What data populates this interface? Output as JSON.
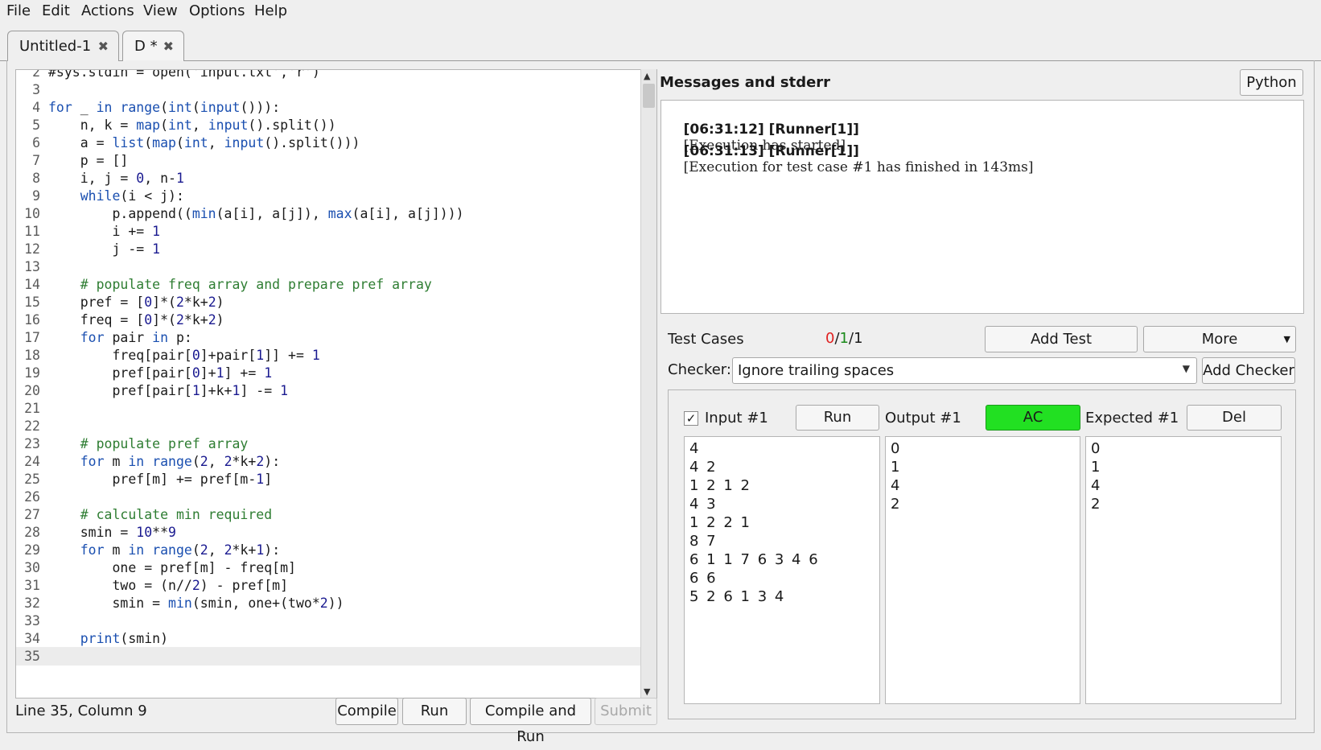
{
  "menu": [
    "File",
    "Edit",
    "Actions",
    "View",
    "Options",
    "Help"
  ],
  "tabs": [
    {
      "label": "Untitled-1"
    },
    {
      "label": "D *"
    }
  ],
  "editor": {
    "lines": [
      {
        "n": "2",
        "html": "#sys.stdin = open('input.txt','r')"
      },
      {
        "n": "3",
        "html": ""
      },
      {
        "n": "4",
        "html": "<span class=\"kw\">for</span> _ <span class=\"kw\">in</span> <span class=\"bi\">range</span>(<span class=\"bi\">int</span>(<span class=\"bi\">input</span>())):"
      },
      {
        "n": "5",
        "html": "    n, k = <span class=\"bi\">map</span>(<span class=\"bi\">int</span>, <span class=\"bi\">input</span>().split())"
      },
      {
        "n": "6",
        "html": "    a = <span class=\"bi\">list</span>(<span class=\"bi\">map</span>(<span class=\"bi\">int</span>, <span class=\"bi\">input</span>().split()))"
      },
      {
        "n": "7",
        "html": "    p = []"
      },
      {
        "n": "8",
        "html": "    i, j = <span class=\"num\">0</span>, n-<span class=\"num\">1</span>"
      },
      {
        "n": "9",
        "html": "    <span class=\"kw\">while</span>(i &lt; j):"
      },
      {
        "n": "10",
        "html": "        p.append((<span class=\"bi\">min</span>(a[i], a[j]), <span class=\"bi\">max</span>(a[i], a[j])))"
      },
      {
        "n": "11",
        "html": "        i += <span class=\"num\">1</span>"
      },
      {
        "n": "12",
        "html": "        j -= <span class=\"num\">1</span>"
      },
      {
        "n": "13",
        "html": ""
      },
      {
        "n": "14",
        "html": "    <span class=\"cmt\"># populate freq array and prepare pref array</span>"
      },
      {
        "n": "15",
        "html": "    pref = [<span class=\"num\">0</span>]*(<span class=\"num\">2</span>*k+<span class=\"num\">2</span>)"
      },
      {
        "n": "16",
        "html": "    freq = [<span class=\"num\">0</span>]*(<span class=\"num\">2</span>*k+<span class=\"num\">2</span>)"
      },
      {
        "n": "17",
        "html": "    <span class=\"kw\">for</span> pair <span class=\"kw\">in</span> p:"
      },
      {
        "n": "18",
        "html": "        freq[pair[<span class=\"num\">0</span>]+pair[<span class=\"num\">1</span>]] += <span class=\"num\">1</span>"
      },
      {
        "n": "19",
        "html": "        pref[pair[<span class=\"num\">0</span>]+<span class=\"num\">1</span>] += <span class=\"num\">1</span>"
      },
      {
        "n": "20",
        "html": "        pref[pair[<span class=\"num\">1</span>]+k+<span class=\"num\">1</span>] -= <span class=\"num\">1</span>"
      },
      {
        "n": "21",
        "html": ""
      },
      {
        "n": "22",
        "html": ""
      },
      {
        "n": "23",
        "html": "    <span class=\"cmt\"># populate pref array</span>"
      },
      {
        "n": "24",
        "html": "    <span class=\"kw\">for</span> m <span class=\"kw\">in</span> <span class=\"bi\">range</span>(<span class=\"num\">2</span>, <span class=\"num\">2</span>*k+<span class=\"num\">2</span>):"
      },
      {
        "n": "25",
        "html": "        pref[m] += pref[m-<span class=\"num\">1</span>]"
      },
      {
        "n": "26",
        "html": ""
      },
      {
        "n": "27",
        "html": "    <span class=\"cmt\"># calculate min required</span>"
      },
      {
        "n": "28",
        "html": "    smin = <span class=\"num\">10</span>**<span class=\"num\">9</span>"
      },
      {
        "n": "29",
        "html": "    <span class=\"kw\">for</span> m <span class=\"kw\">in</span> <span class=\"bi\">range</span>(<span class=\"num\">2</span>, <span class=\"num\">2</span>*k+<span class=\"num\">1</span>):"
      },
      {
        "n": "30",
        "html": "        one = pref[m] - freq[m]"
      },
      {
        "n": "31",
        "html": "        two = (n//<span class=\"num\">2</span>) - pref[m]"
      },
      {
        "n": "32",
        "html": "        smin = <span class=\"bi\">min</span>(smin, one+(two*<span class=\"num\">2</span>))"
      },
      {
        "n": "33",
        "html": ""
      },
      {
        "n": "34",
        "html": "    <span class=\"bi\">print</span>(smin)"
      },
      {
        "n": "35",
        "html": "",
        "current": true
      }
    ]
  },
  "status": {
    "position": "Line 35, Column 9"
  },
  "toolbar": {
    "compile": "Compile",
    "run": "Run",
    "compile_and_run": "Compile and Run",
    "submit": "Submit"
  },
  "messages": {
    "title": "Messages and stderr",
    "language": "Python",
    "lines": [
      {
        "ts": "[06:31:12] [Runner[1]]",
        "text": "[Execution has started]"
      },
      {
        "ts": "[06:31:13] [Runner[1]]",
        "text": "[Execution for test case #1 has finished in 143ms]"
      }
    ]
  },
  "tests": {
    "label": "Test Cases",
    "failed": "0",
    "passed": "1",
    "total": "1",
    "sep": "/",
    "add_test": "Add Test",
    "more": "More",
    "checker_label": "Checker:",
    "checker_value": "Ignore trailing spaces",
    "add_checker": "Add Checker",
    "case": {
      "checked": "✓",
      "input_label": "Input #1",
      "run": "Run",
      "output_label": "Output #1",
      "verdict": "AC",
      "expected_label": "Expected #1",
      "del": "Del",
      "input_lines": [
        "4",
        "4 2",
        "1 2 1 2",
        "4 3",
        "1 2 2 1",
        "8 7",
        "6 1 1 7 6 3 4 6",
        "6 6",
        "5 2 6 1 3 4"
      ],
      "output_lines": [
        "0",
        "1",
        "4",
        "2"
      ],
      "expected_lines": [
        "0",
        "1",
        "4",
        "2"
      ]
    }
  },
  "colors": {
    "verdict_ac": "#22e022",
    "fail_count": "#e02020",
    "pass_count": "#1a8a1a"
  }
}
